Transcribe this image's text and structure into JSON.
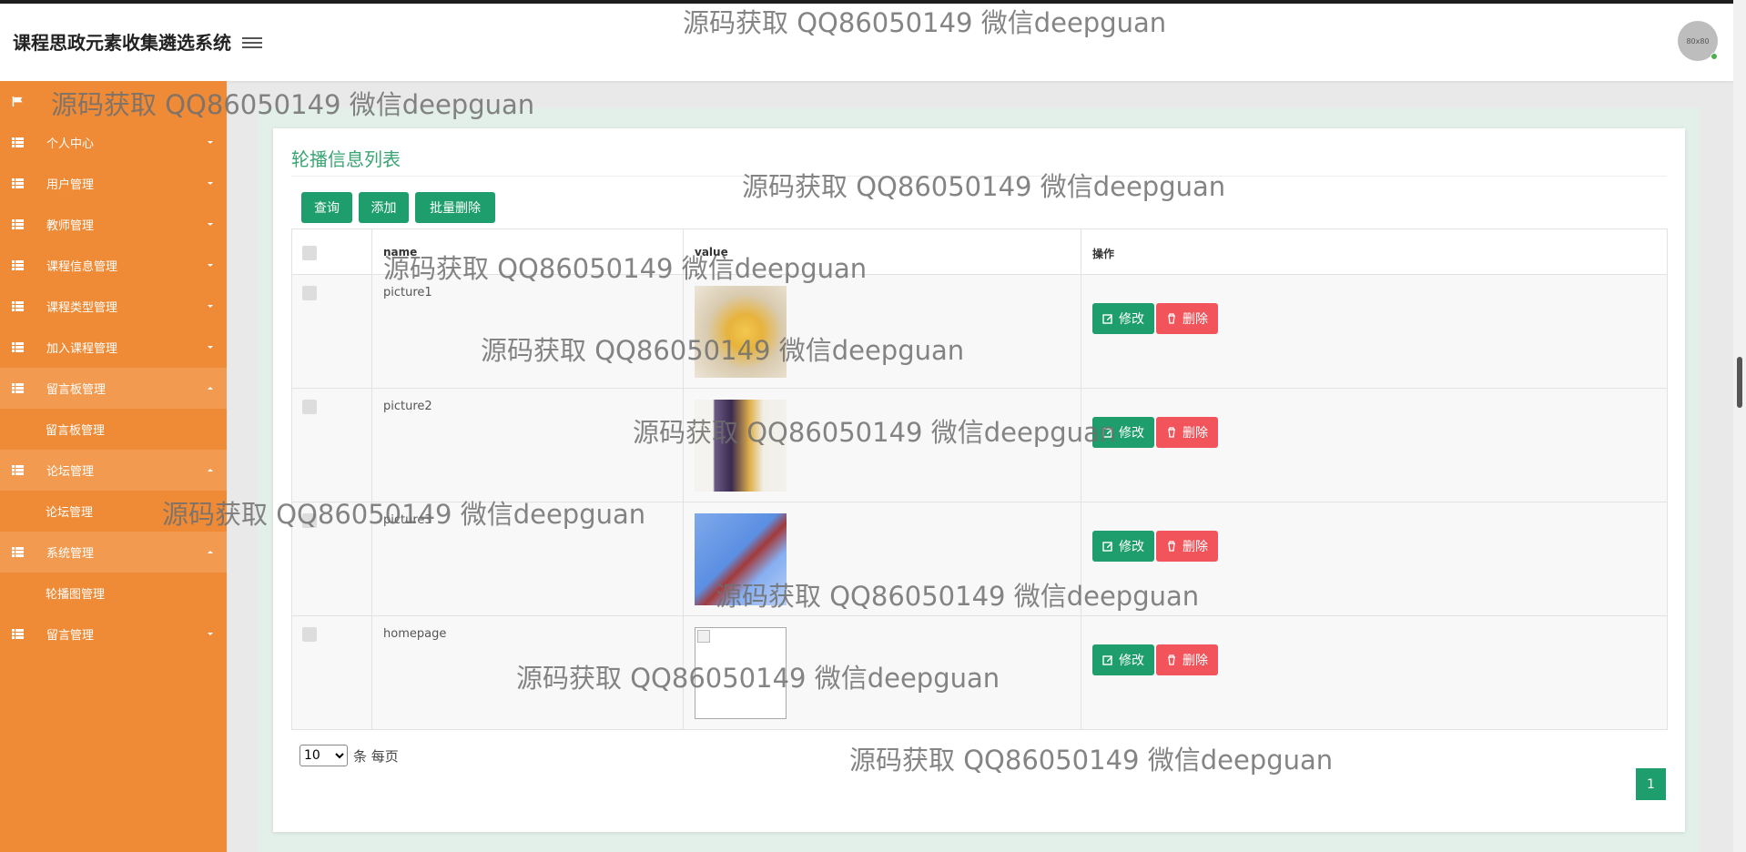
{
  "header": {
    "title": "课程思政元素收集遴选系统",
    "avatar_text": "80x80"
  },
  "sidebar": {
    "home": "",
    "items": [
      {
        "label": "个人中心",
        "expanded": false
      },
      {
        "label": "用户管理",
        "expanded": false
      },
      {
        "label": "教师管理",
        "expanded": false
      },
      {
        "label": "课程信息管理",
        "expanded": false
      },
      {
        "label": "课程类型管理",
        "expanded": false
      },
      {
        "label": "加入课程管理",
        "expanded": false
      },
      {
        "label": "留言板管理",
        "expanded": true,
        "sub": "留言板管理"
      },
      {
        "label": "论坛管理",
        "expanded": true,
        "sub": "论坛管理"
      },
      {
        "label": "系统管理",
        "expanded": true,
        "sub": "轮播图管理"
      },
      {
        "label": "留言管理",
        "expanded": false
      }
    ]
  },
  "main": {
    "title": "轮播信息列表",
    "buttons": {
      "query": "查询",
      "add": "添加",
      "batch_delete": "批量删除"
    },
    "columns": {
      "name": "name",
      "value": "value",
      "actions": "操作"
    },
    "rows": [
      {
        "name": "picture1",
        "edit": "修改",
        "delete": "删除"
      },
      {
        "name": "picture2",
        "edit": "修改",
        "delete": "删除"
      },
      {
        "name": "picture3",
        "edit": "修改",
        "delete": "删除"
      },
      {
        "name": "homepage",
        "edit": "修改",
        "delete": "删除"
      }
    ],
    "pager": {
      "page_size": "10",
      "suffix": "条 每页",
      "current_page": "1"
    }
  },
  "watermark": "源码获取 QQ86050149 微信deepguan",
  "colors": {
    "sidebar": "#ef8b36",
    "accent": "#1e9e6c",
    "danger": "#f2545b",
    "title": "#3aa573"
  }
}
